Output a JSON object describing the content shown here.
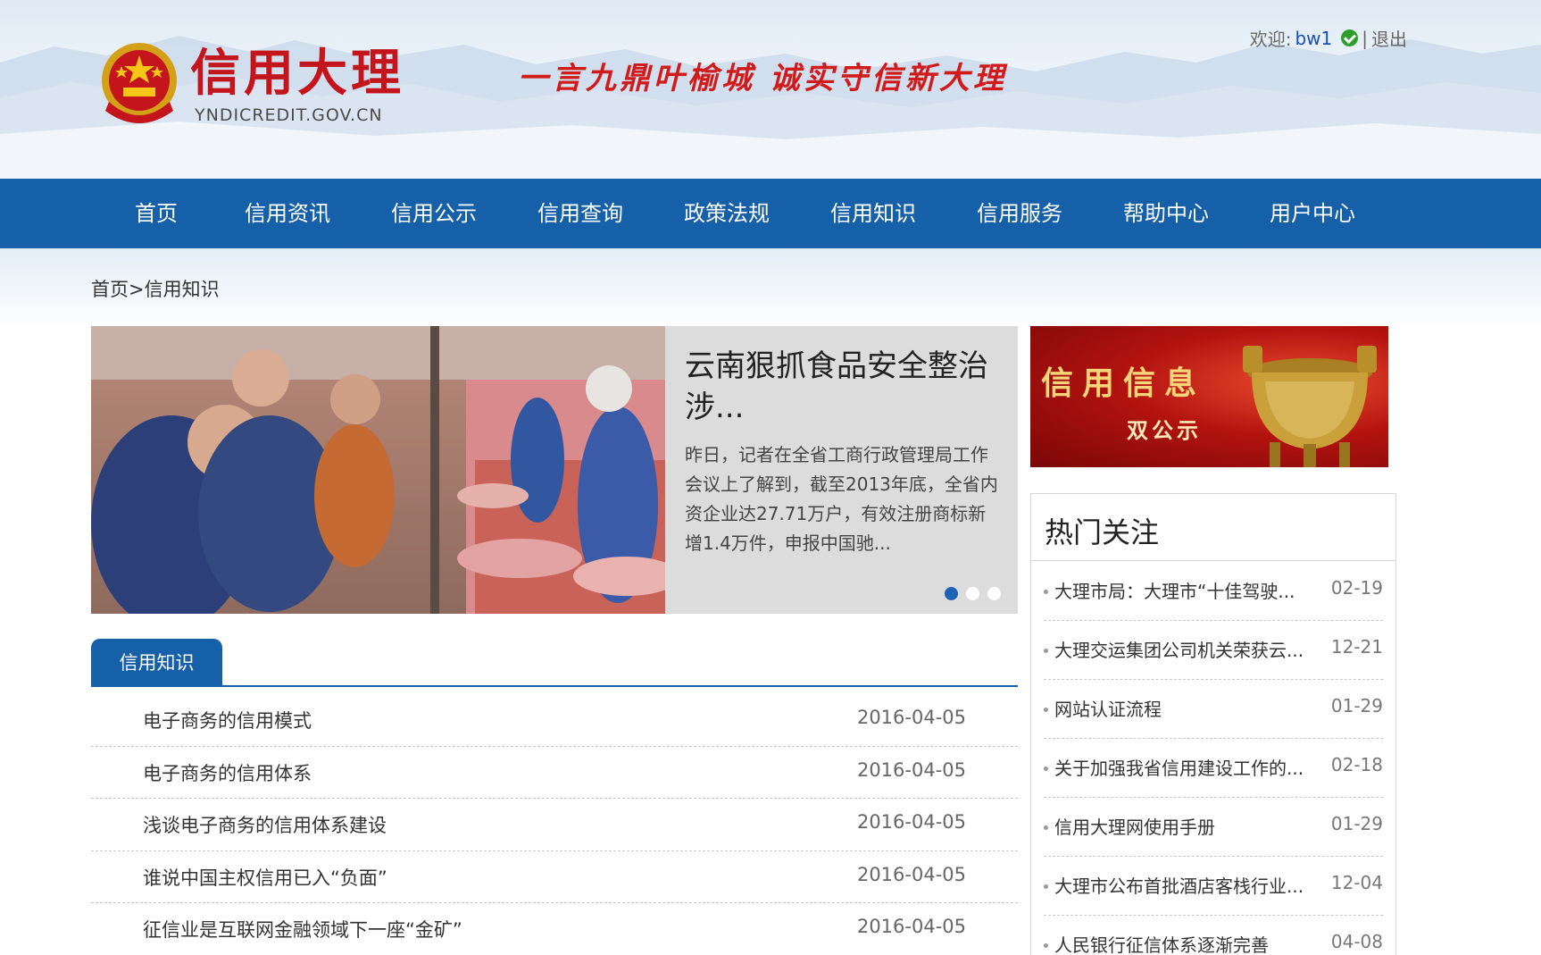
{
  "header": {
    "logo_title": "信用大理",
    "logo_domain": "YNDICREDIT.GOV.CN",
    "slogan": "一言九鼎叶榆城 诚实守信新大理",
    "welcome_label": "欢迎:",
    "username": "bw1",
    "separator": "|",
    "logout": "退出"
  },
  "nav": {
    "items": [
      {
        "label": "首页"
      },
      {
        "label": "信用资讯"
      },
      {
        "label": "信用公示"
      },
      {
        "label": "信用查询"
      },
      {
        "label": "政策法规"
      },
      {
        "label": "信用知识"
      },
      {
        "label": "信用服务"
      },
      {
        "label": "帮助中心"
      },
      {
        "label": "用户中心"
      }
    ]
  },
  "breadcrumb": {
    "home": "首页",
    "separator": ">",
    "current": "信用知识"
  },
  "feature": {
    "title": "云南狠抓食品安全整治涉...",
    "summary": "昨日，记者在全省工商行政管理局工作会议上了解到，截至2013年底，全省内资企业达27.71万户，有效注册商标新增1.4万件，申报中国驰...",
    "slide_count": 3,
    "active_slide": 1
  },
  "banner": {
    "main": "信用信息",
    "sub": "双公示"
  },
  "tab": {
    "active_label": "信用知识"
  },
  "articles": [
    {
      "title": "电子商务的信用模式",
      "date": "2016-04-05"
    },
    {
      "title": "电子商务的信用体系",
      "date": "2016-04-05"
    },
    {
      "title": "浅谈电子商务的信用体系建设",
      "date": "2016-04-05"
    },
    {
      "title": "谁说中国主权信用已入“负面”",
      "date": "2016-04-05"
    },
    {
      "title": "征信业是互联网金融领域下一座“金矿”",
      "date": "2016-04-05"
    }
  ],
  "hot": {
    "title": "热门关注",
    "items": [
      {
        "title": "大理市局：大理市“十佳驾驶...",
        "date": "02-19"
      },
      {
        "title": "大理交运集团公司机关荣获云...",
        "date": "12-21"
      },
      {
        "title": "网站认证流程",
        "date": "01-29"
      },
      {
        "title": "关于加强我省信用建设工作的...",
        "date": "02-18"
      },
      {
        "title": "信用大理网使用手册",
        "date": "01-29"
      },
      {
        "title": "大理市公布首批酒店客栈行业...",
        "date": "12-04"
      },
      {
        "title": "人民银行征信体系逐渐完善",
        "date": "04-08"
      }
    ]
  },
  "colors": {
    "nav_blue": "#1560a9",
    "brand_red": "#c4151c",
    "dot_active": "#1d63b4",
    "link_blue": "#1a4fb8"
  }
}
